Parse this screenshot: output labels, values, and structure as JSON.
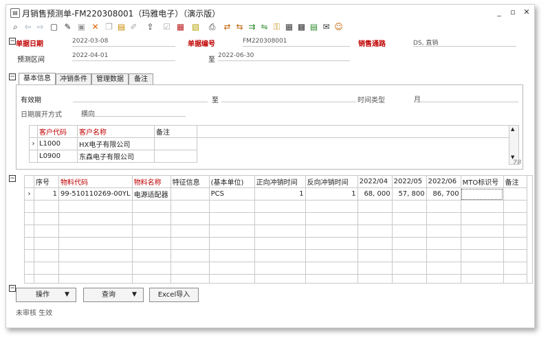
{
  "window": {
    "title": "月销售预测单-FM220308001（玛雅电子）（演示版）",
    "minimize": "_",
    "maximize": "▫",
    "close": "✕"
  },
  "toolbar": {
    "icons": [
      "search-doc",
      "arrow-left",
      "arrow-right",
      "new",
      "edit",
      "save",
      "delete",
      "copy",
      "paste",
      "attach",
      "submit",
      "approve",
      "report",
      "chart",
      "print",
      "route",
      "split",
      "merge",
      "link",
      "lock",
      "grid",
      "excel",
      "mail",
      "chat"
    ]
  },
  "header": {
    "doc_date_label": "单据日期",
    "doc_date_value": "2022-03-08",
    "doc_no_label": "单据编号",
    "doc_no_value": "FM220308001",
    "sales_channel_label": "销售通路",
    "sales_channel_value": "DS, 直销",
    "period_label": "预测区间",
    "period_from": "2022-04-01",
    "period_to_label": "至",
    "period_to": "2022-06-30"
  },
  "tabs": [
    "基本信息",
    "冲销条件",
    "管理数据",
    "备注"
  ],
  "basic": {
    "valid_label": "有效期",
    "valid_to_label": "至",
    "time_type_label": "时间类型",
    "time_type_value": "月",
    "expand_label": "日期展开方式",
    "expand_value": "横向"
  },
  "customers": {
    "headers": [
      "客户代码",
      "客户名称",
      "备注"
    ],
    "rows": [
      {
        "code": "L1000",
        "name": "HX电子有限公司",
        "remark": ""
      },
      {
        "code": "L0900",
        "name": "东森电子有限公司",
        "remark": ""
      }
    ],
    "scroll_tag": "78"
  },
  "lines": {
    "headers": [
      "序号",
      "物料代码",
      "物料名称",
      "特征信息",
      "(基本单位)",
      "正向冲销时间",
      "反向冲销时间",
      "2022/04",
      "2022/05",
      "2022/06",
      "MTO标识号",
      "备注"
    ],
    "rows": [
      {
        "seq": "1",
        "code": "99-510110269-00YL",
        "name": "电源适配器",
        "feature": "",
        "unit": "PCS",
        "fwd": "1",
        "rev": "1",
        "m4": "68, 000",
        "m5": "57, 800",
        "m6": "86, 700",
        "mto": "",
        "remark": ""
      }
    ]
  },
  "actions": {
    "operate": "操作",
    "query": "查询",
    "excel": "Excel导入"
  },
  "status": "未审核 生效"
}
